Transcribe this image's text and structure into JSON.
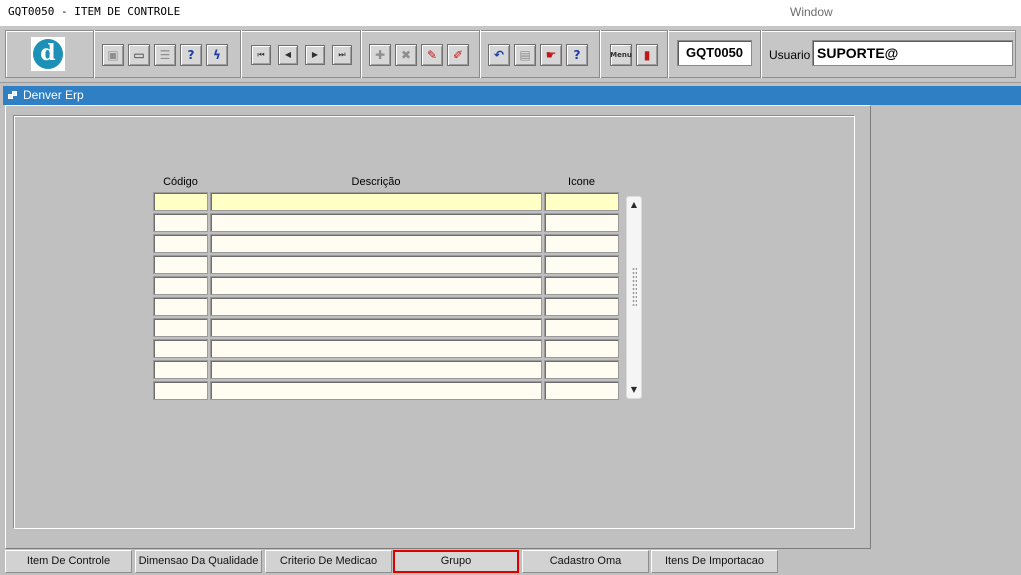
{
  "app": {
    "title": "GQT0050 - ITEM DE CONTROLE",
    "window_menu": "Window"
  },
  "toolbar": {
    "logo_letter": "d",
    "form_code": "GQT0050",
    "user_label": "Usuario",
    "user_value": "SUPORTE@",
    "buttons": [
      {
        "name": "save-icon",
        "glyph": "▣"
      },
      {
        "name": "window-icon",
        "glyph": "▭"
      },
      {
        "name": "print-icon",
        "glyph": "☰"
      },
      {
        "name": "query-icon",
        "glyph": "?"
      },
      {
        "name": "execute-query-icon",
        "glyph": "ϟ"
      },
      {
        "name": "first-record-icon",
        "glyph": "⏮"
      },
      {
        "name": "previous-record-icon",
        "glyph": "◀"
      },
      {
        "name": "next-record-icon",
        "glyph": "▶"
      },
      {
        "name": "last-record-icon",
        "glyph": "⏭"
      },
      {
        "name": "insert-record-icon",
        "glyph": "✚"
      },
      {
        "name": "delete-record-icon",
        "glyph": "✖"
      },
      {
        "name": "edit-record-icon",
        "glyph": "✎"
      },
      {
        "name": "clear-icon",
        "glyph": "✐"
      },
      {
        "name": "undo-icon",
        "glyph": "↶"
      },
      {
        "name": "clipboard-icon",
        "glyph": "▤"
      },
      {
        "name": "hand-icon",
        "glyph": "☛"
      },
      {
        "name": "help-icon",
        "glyph": "?"
      },
      {
        "name": "menu-icon",
        "glyph": "Menu"
      },
      {
        "name": "exit-icon",
        "glyph": "▮"
      }
    ]
  },
  "window": {
    "title": "Denver Erp"
  },
  "grid": {
    "columns": [
      "Código",
      "Descrição",
      "Icone"
    ],
    "row_count": 10
  },
  "tabs": [
    {
      "label": "Item De Controle"
    },
    {
      "label": "Dimensao Da Qualidade"
    },
    {
      "label": "Criterio De Medicao"
    },
    {
      "label": "Grupo",
      "selected": true
    },
    {
      "label": "Cadastro Oma"
    },
    {
      "label": "Itens De Importacao"
    }
  ]
}
